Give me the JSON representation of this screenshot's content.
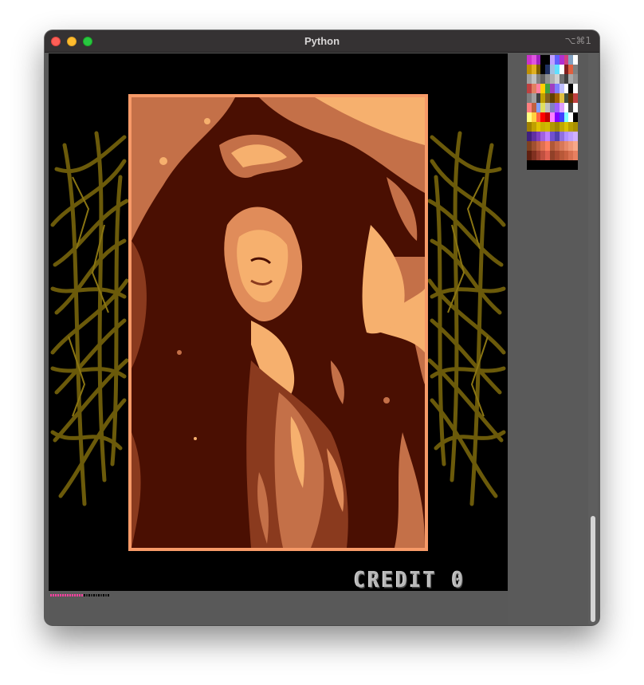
{
  "window": {
    "title": "Python",
    "shortcut": "⌥⌘1"
  },
  "game": {
    "credit_label": "CREDIT",
    "credit_value": "0",
    "frame_color": "#f79a68",
    "photo_dark_color": "#4a0f02",
    "photo_light_color": "#f6b06e",
    "vine_color": "#6b5a0a"
  },
  "palette": {
    "rows": [
      [
        "#cc33cc",
        "#e055e0",
        "#a020c0",
        "#000000",
        "#000000",
        "#c0a0ff",
        "#6060ff",
        "#b030d0",
        "#d04080",
        "#80a0c0",
        "#ffffff"
      ],
      [
        "#c09000",
        "#e0b020",
        "#806000",
        "#000000",
        "#203060",
        "#a0c0e0",
        "#60e0ff",
        "#ffffff",
        "#802020",
        "#e06040",
        "#808080"
      ],
      [
        "#a0a0a0",
        "#c0c0c0",
        "#808080",
        "#606060",
        "#909090",
        "#b0b0b0",
        "#d0d0d0",
        "#707070",
        "#404040",
        "#a8a8a8",
        "#909090"
      ],
      [
        "#c04040",
        "#e08060",
        "#ff80a0",
        "#ffd000",
        "#40a040",
        "#a040c0",
        "#8080ff",
        "#c0c0ff",
        "#ffffff",
        "#000000",
        "#ffffff"
      ],
      [
        "#808080",
        "#a0a0a0",
        "#404040",
        "#c0a000",
        "#806020",
        "#604000",
        "#a06000",
        "#e0c040",
        "#405040",
        "#603000",
        "#c04040"
      ],
      [
        "#ff8080",
        "#c06040",
        "#80a0ff",
        "#e0e060",
        "#c0c0c0",
        "#8080c0",
        "#a060ff",
        "#e0a0ff",
        "#ffffff",
        "#404040",
        "#ffffff"
      ],
      [
        "#ffff80",
        "#ffd040",
        "#ff6040",
        "#ff0000",
        "#c00000",
        "#ff80ff",
        "#8000ff",
        "#4040ff",
        "#80ffff",
        "#ffffff",
        "#000000"
      ],
      [
        "#a08000",
        "#c0a000",
        "#e0c000",
        "#c8b000",
        "#d0b800",
        "#b09800",
        "#a08800",
        "#c0a800",
        "#d8c000",
        "#b8a000",
        "#a89000"
      ],
      [
        "#402080",
        "#6030a0",
        "#8040c0",
        "#a060e0",
        "#c080ff",
        "#7050d0",
        "#5040b0",
        "#9070e0",
        "#b090ff",
        "#c0a0ff",
        "#d0b0ff"
      ],
      [
        "#804020",
        "#a05030",
        "#c06040",
        "#e07050",
        "#ff8060",
        "#b05838",
        "#c86848",
        "#d87858",
        "#e88868",
        "#f09878",
        "#f8a888"
      ],
      [
        "#602010",
        "#803020",
        "#a04030",
        "#c05040",
        "#e06050",
        "#904028",
        "#a84830",
        "#b85838",
        "#c86040",
        "#d87050",
        "#e88060"
      ],
      [
        "#000000",
        "#000000",
        "#000000",
        "#000000",
        "#000000",
        "#000000",
        "#000000",
        "#000000",
        "#000000",
        "#000000",
        "#000000"
      ]
    ]
  },
  "debug_strip": {
    "colors": [
      "#ff40a0",
      "#ff40a0",
      "#ff40a0",
      "#ff40a0",
      "#ff40a0",
      "#ff40a0",
      "#ff40a0",
      "#ff40a0",
      "#ff40a0",
      "#ff40a0",
      "#ff40a0",
      "#ff40a0",
      "#ff40a0",
      "#ff40a0",
      "#000000",
      "#202020",
      "#000000",
      "#202020",
      "#000000",
      "#202020",
      "#000000",
      "#202020",
      "#000000",
      "#202020",
      "#000000"
    ]
  }
}
